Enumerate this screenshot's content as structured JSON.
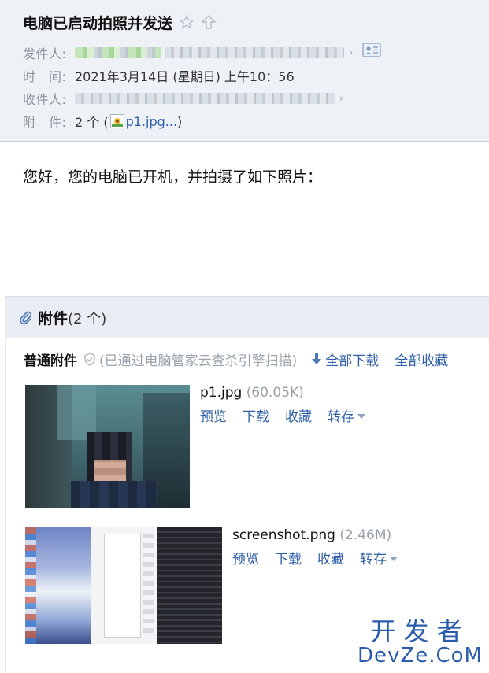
{
  "header": {
    "subject": "电脑已启动拍照并发送",
    "sender_label": "发件人:",
    "time_label": "时　间:",
    "time_value": "2021年3月14日 (星期日) 上午10：56",
    "recipient_label": "收件人:",
    "attachments_label": "附　件:",
    "attachments_value_prefix": "2 个 (",
    "attachments_value_file": "p1.jpg...",
    "attachments_value_suffix": ")"
  },
  "body": {
    "text": "您好，您的电脑已开机，并拍摄了如下照片："
  },
  "attachments": {
    "title": "附件",
    "count": "(2 个)",
    "section_label": "普通附件",
    "scan_note": "(已通过电脑管家云查杀引擎扫描)",
    "download_all": "全部下载",
    "save_all": "全部收藏",
    "items": [
      {
        "name": "p1.jpg",
        "size": "(60.05K)",
        "actions": [
          "预览",
          "下载",
          "收藏",
          "转存"
        ]
      },
      {
        "name": "screenshot.png",
        "size": "(2.46M)",
        "actions": [
          "预览",
          "下载",
          "收藏",
          "转存"
        ]
      }
    ]
  },
  "watermark": {
    "line1": "开发者",
    "line2": "DevZe.CoM"
  },
  "colors": {
    "header_bg": "#eef2f7",
    "link": "#2e5fa8",
    "muted": "#8b939b"
  }
}
